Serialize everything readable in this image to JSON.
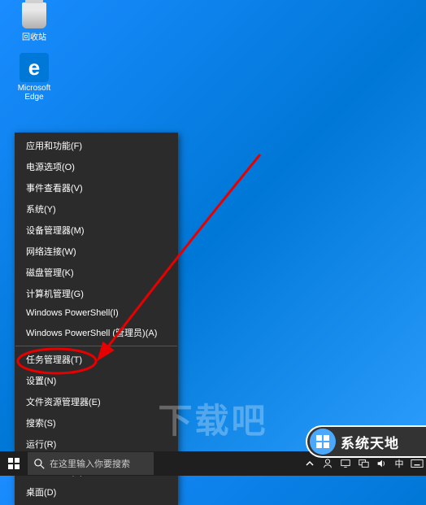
{
  "desktop": {
    "recycle_bin": "回收站",
    "edge": "Microsoft Edge",
    "edge_letter": "e"
  },
  "context_menu": {
    "items": [
      {
        "label": "应用和功能(F)"
      },
      {
        "label": "电源选项(O)"
      },
      {
        "label": "事件查看器(V)"
      },
      {
        "label": "系统(Y)"
      },
      {
        "label": "设备管理器(M)"
      },
      {
        "label": "网络连接(W)"
      },
      {
        "label": "磁盘管理(K)"
      },
      {
        "label": "计算机管理(G)"
      },
      {
        "label": "Windows PowerShell(I)"
      },
      {
        "label": "Windows PowerShell (管理员)(A)"
      },
      {
        "divider": true
      },
      {
        "label": "任务管理器(T)"
      },
      {
        "label": "设置(N)",
        "highlighted": true
      },
      {
        "label": "文件资源管理器(E)"
      },
      {
        "label": "搜索(S)"
      },
      {
        "label": "运行(R)"
      },
      {
        "divider": true
      },
      {
        "label": "关机或注销(U)",
        "submenu": true
      },
      {
        "label": "桌面(D)"
      }
    ]
  },
  "watermark_left": "下载吧",
  "watermark_right": "系统天地",
  "taskbar": {
    "search_placeholder": "在这里输入你要搜索"
  }
}
